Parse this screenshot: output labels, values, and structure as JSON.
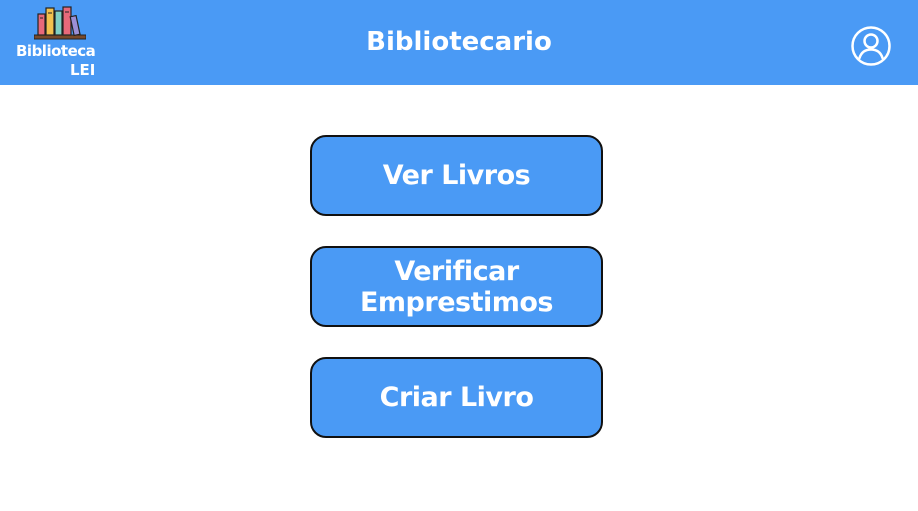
{
  "header": {
    "title": "Bibliotecario",
    "logo_line1": "Biblioteca",
    "logo_line2": "LEI",
    "logo_icon": "books-on-shelf-icon",
    "profile_icon": "user-circle-icon",
    "background_color": "#4a9af5"
  },
  "menu": {
    "ver_livros_label": "Ver Livros",
    "verificar_emprestimos_label": "Verificar Emprestimos",
    "criar_livro_label": "Criar Livro",
    "button_color": "#4a9af5",
    "border_color": "#111111"
  }
}
